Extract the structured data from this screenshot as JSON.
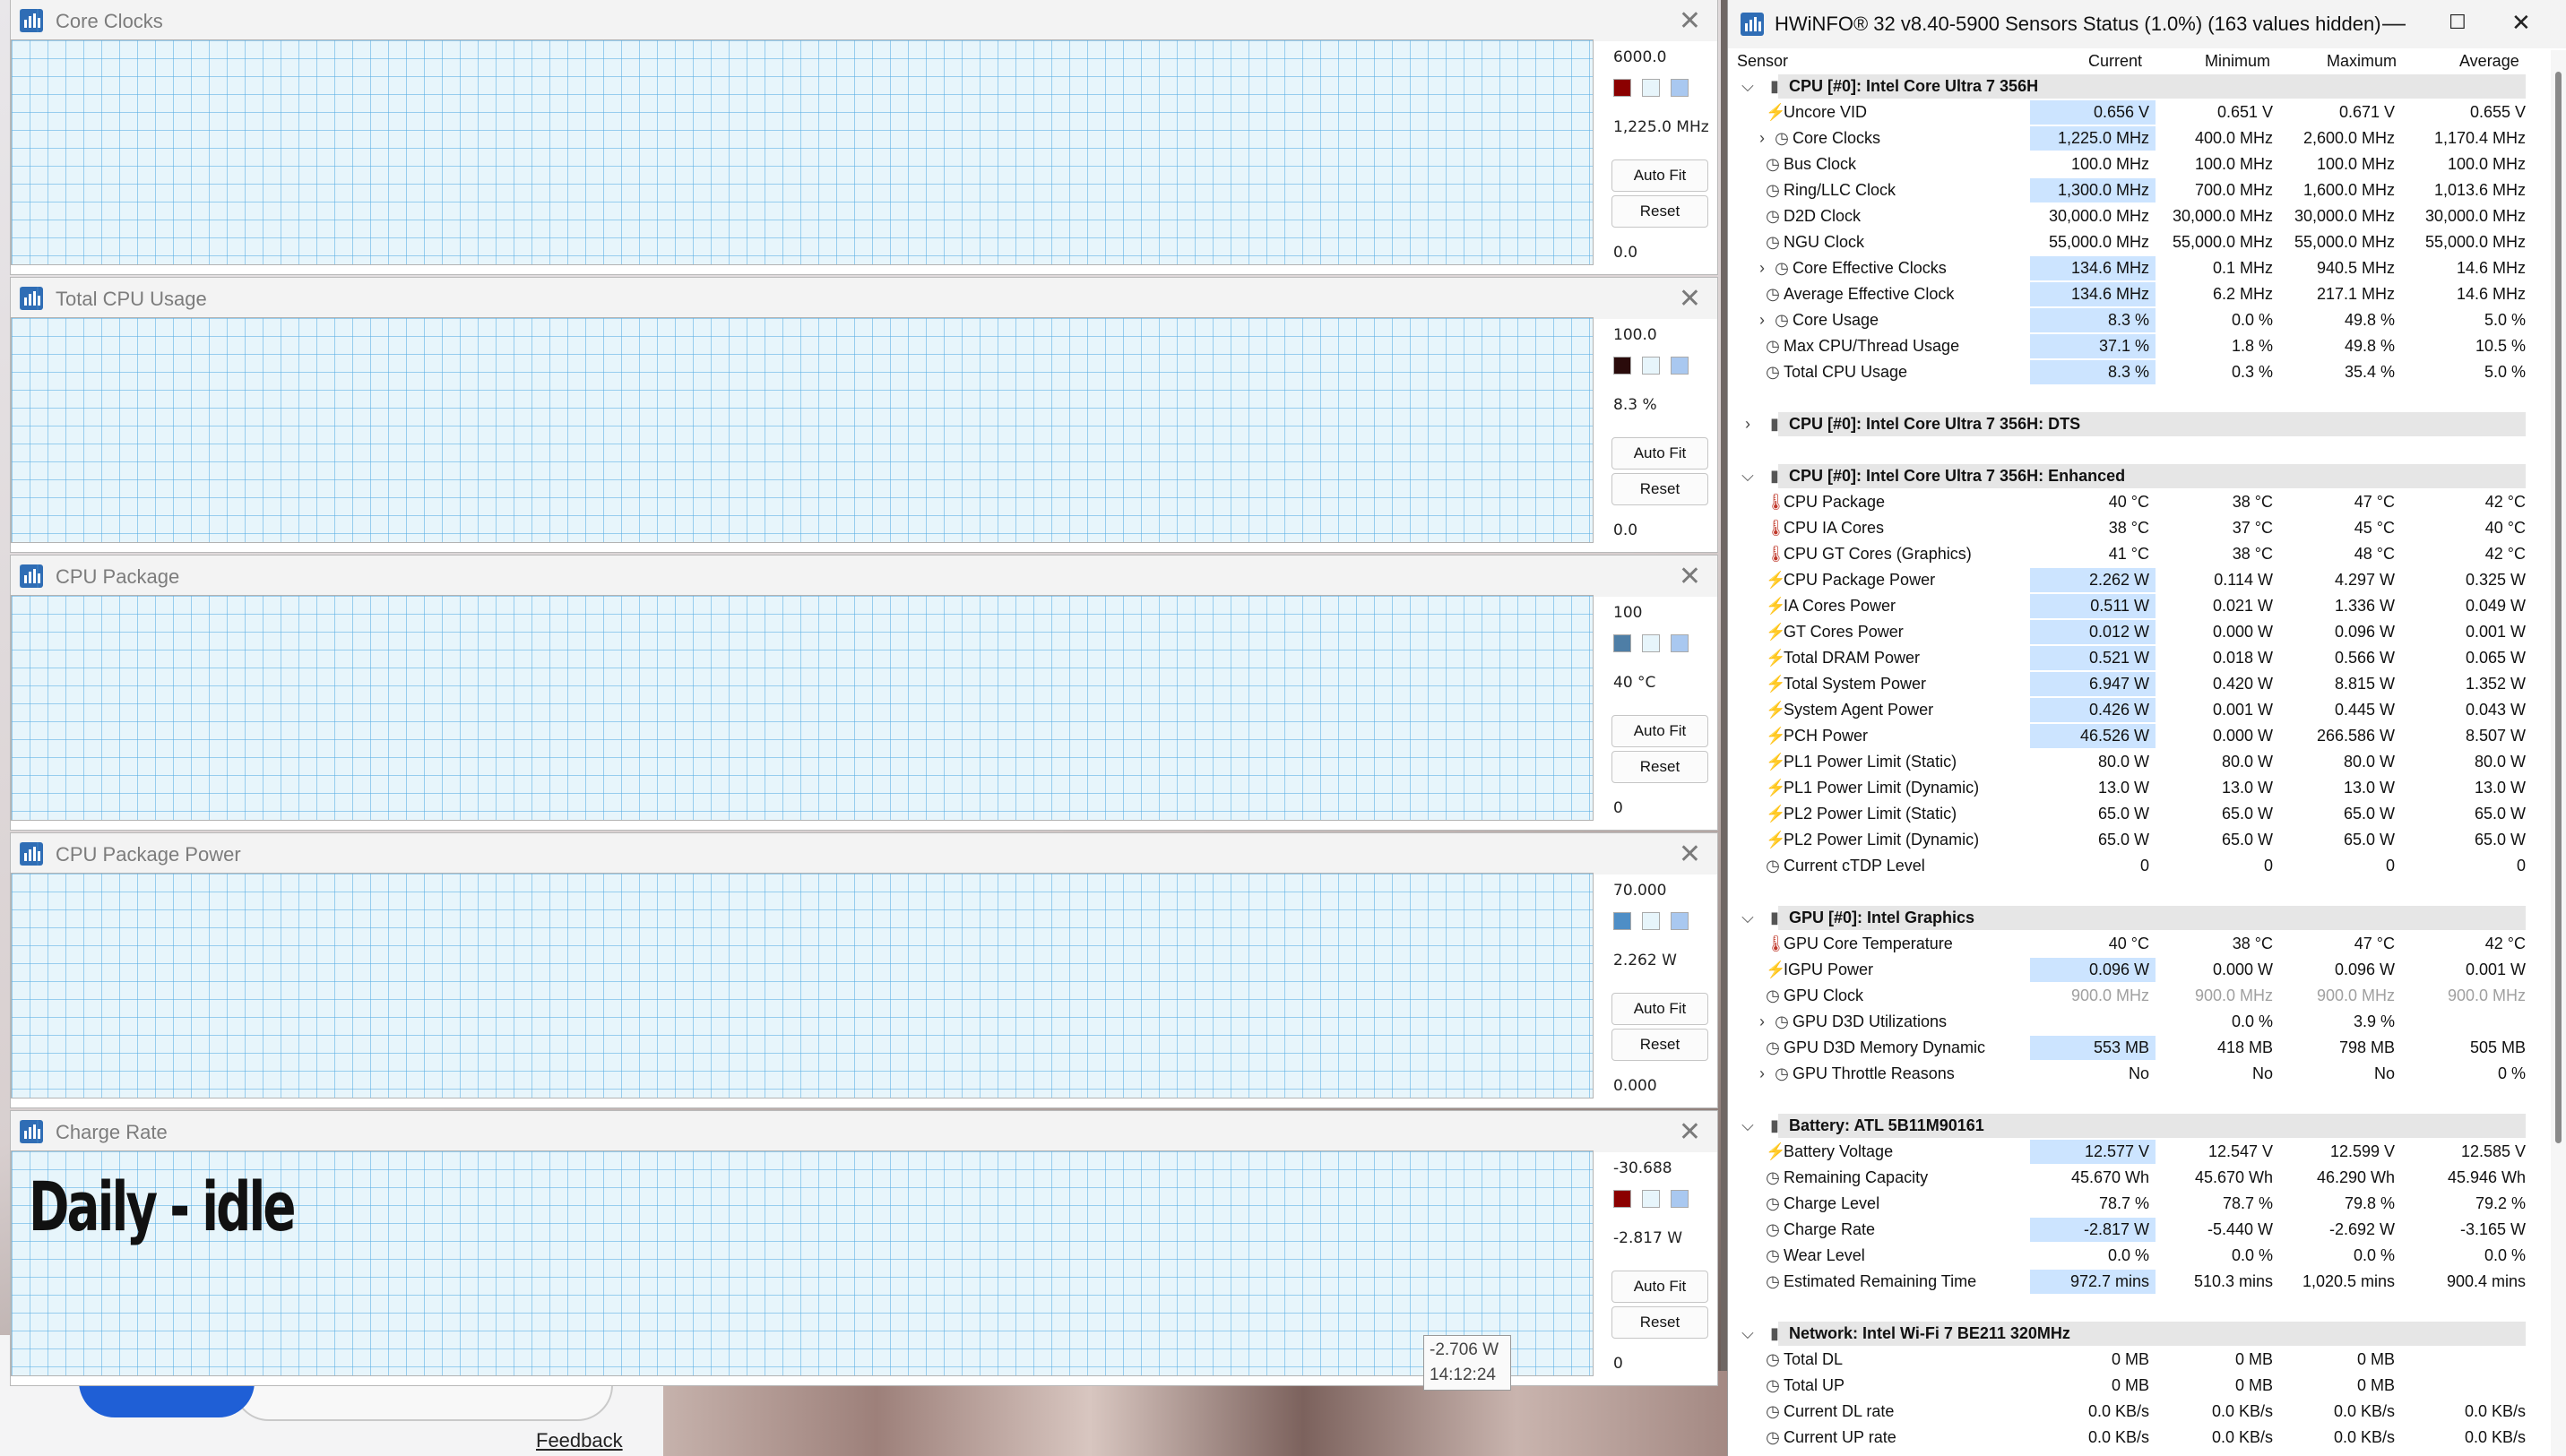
{
  "graphs": [
    {
      "title": "Core Clocks",
      "max": "6000.0",
      "cur": "1,225.0 MHz",
      "min": "0.0",
      "autofit": "Auto Fit",
      "reset": "Reset",
      "color": "#a50f0f",
      "sw1": "#8b0000",
      "sw2": "#e7f5fb",
      "sw3": "#a9c8f0"
    },
    {
      "title": "Total CPU Usage",
      "max": "100.0",
      "cur": "8.3 %",
      "min": "0.0",
      "autofit": "Auto Fit",
      "reset": "Reset",
      "color": "#5e1214",
      "sw1": "#2a0b0b",
      "sw2": "#e7f5fb",
      "sw3": "#a9c8f0"
    },
    {
      "title": "CPU Package",
      "max": "100",
      "cur": "40 °C",
      "min": "0",
      "autofit": "Auto Fit",
      "reset": "Reset",
      "color": "#254350",
      "sw1": "#4e7ea6",
      "sw2": "#e7f5fb",
      "sw3": "#a9c8f0"
    },
    {
      "title": "CPU Package Power",
      "max": "70.000",
      "cur": "2.262 W",
      "min": "0.000",
      "autofit": "Auto Fit",
      "reset": "Reset",
      "color": "#254350",
      "sw1": "#4e8ec6",
      "sw2": "#e7f5fb",
      "sw3": "#a9c8f0"
    },
    {
      "title": "Charge Rate",
      "max": "-30.688",
      "cur": "-2.817 W",
      "min": "0",
      "autofit": "Auto Fit",
      "reset": "Reset",
      "color": "#a50f0f",
      "sw1": "#8b0000",
      "sw2": "#e7f5fb",
      "sw3": "#a9c8f0"
    }
  ],
  "overlay": {
    "text": "Daily - idle",
    "tooltip_value": "-2.706 W",
    "tooltip_time": "14:12:24"
  },
  "desktop": {
    "feedback": "Feedback"
  },
  "hwinfo": {
    "title": "HWiNFO® 32 v8.40-5900 Sensors Status (1.0%) (163 values hidden)",
    "columns": {
      "sensor": "Sensor",
      "current": "Current",
      "minimum": "Minimum",
      "maximum": "Maximum",
      "average": "Average"
    },
    "rows": [
      {
        "t": "g",
        "name": "CPU [#0]: Intel Core Ultra 7 356H",
        "exp": "v"
      },
      {
        "t": "r",
        "icon": "bolt",
        "name": "Uncore VID",
        "cur": "0.656 V",
        "min": "0.651 V",
        "max": "0.671 V",
        "avg": "0.655 V",
        "hl": true
      },
      {
        "t": "r",
        "icon": "clock",
        "exp": ">",
        "name": "Core Clocks",
        "cur": "1,225.0 MHz",
        "min": "400.0 MHz",
        "max": "2,600.0 MHz",
        "avg": "1,170.4 MHz",
        "hl": true,
        "sub": true
      },
      {
        "t": "r",
        "icon": "clock",
        "name": "Bus Clock",
        "cur": "100.0 MHz",
        "min": "100.0 MHz",
        "max": "100.0 MHz",
        "avg": "100.0 MHz"
      },
      {
        "t": "r",
        "icon": "clock",
        "name": "Ring/LLC Clock",
        "cur": "1,300.0 MHz",
        "min": "700.0 MHz",
        "max": "1,600.0 MHz",
        "avg": "1,013.6 MHz",
        "hl": true
      },
      {
        "t": "r",
        "icon": "clock",
        "name": "D2D Clock",
        "cur": "30,000.0 MHz",
        "min": "30,000.0 MHz",
        "max": "30,000.0 MHz",
        "avg": "30,000.0 MHz"
      },
      {
        "t": "r",
        "icon": "clock",
        "name": "NGU Clock",
        "cur": "55,000.0 MHz",
        "min": "55,000.0 MHz",
        "max": "55,000.0 MHz",
        "avg": "55,000.0 MHz"
      },
      {
        "t": "r",
        "icon": "clock",
        "exp": ">",
        "name": "Core Effective Clocks",
        "cur": "134.6 MHz",
        "min": "0.1 MHz",
        "max": "940.5 MHz",
        "avg": "14.6 MHz",
        "hl": true,
        "sub": true
      },
      {
        "t": "r",
        "icon": "clock",
        "name": "Average Effective Clock",
        "cur": "134.6 MHz",
        "min": "6.2 MHz",
        "max": "217.1 MHz",
        "avg": "14.6 MHz",
        "hl": true
      },
      {
        "t": "r",
        "icon": "clock",
        "exp": ">",
        "name": "Core Usage",
        "cur": "8.3 %",
        "min": "0.0 %",
        "max": "49.8 %",
        "avg": "5.0 %",
        "hl": true,
        "sub": true
      },
      {
        "t": "r",
        "icon": "clock",
        "name": "Max CPU/Thread Usage",
        "cur": "37.1 %",
        "min": "1.8 %",
        "max": "49.8 %",
        "avg": "10.5 %",
        "hl": true
      },
      {
        "t": "r",
        "icon": "clock",
        "name": "Total CPU Usage",
        "cur": "8.3 %",
        "min": "0.3 %",
        "max": "35.4 %",
        "avg": "5.0 %",
        "hl": true
      },
      {
        "t": "s"
      },
      {
        "t": "g",
        "name": "CPU [#0]: Intel Core Ultra 7 356H: DTS",
        "exp": ">"
      },
      {
        "t": "s"
      },
      {
        "t": "g",
        "name": "CPU [#0]: Intel Core Ultra 7 356H: Enhanced",
        "exp": "v"
      },
      {
        "t": "r",
        "icon": "temp",
        "name": "CPU Package",
        "cur": "40 °C",
        "min": "38 °C",
        "max": "47 °C",
        "avg": "42 °C"
      },
      {
        "t": "r",
        "icon": "temp",
        "name": "CPU IA Cores",
        "cur": "38 °C",
        "min": "37 °C",
        "max": "45 °C",
        "avg": "40 °C"
      },
      {
        "t": "r",
        "icon": "temp",
        "name": "CPU GT Cores (Graphics)",
        "cur": "41 °C",
        "min": "38 °C",
        "max": "48 °C",
        "avg": "42 °C"
      },
      {
        "t": "r",
        "icon": "bolt",
        "name": "CPU Package Power",
        "cur": "2.262 W",
        "min": "0.114 W",
        "max": "4.297 W",
        "avg": "0.325 W",
        "hl": true
      },
      {
        "t": "r",
        "icon": "bolt",
        "name": "IA Cores Power",
        "cur": "0.511 W",
        "min": "0.021 W",
        "max": "1.336 W",
        "avg": "0.049 W",
        "hl": true
      },
      {
        "t": "r",
        "icon": "bolt",
        "name": "GT Cores Power",
        "cur": "0.012 W",
        "min": "0.000 W",
        "max": "0.096 W",
        "avg": "0.001 W",
        "hl": true
      },
      {
        "t": "r",
        "icon": "bolt",
        "name": "Total DRAM Power",
        "cur": "0.521 W",
        "min": "0.018 W",
        "max": "0.566 W",
        "avg": "0.065 W",
        "hl": true
      },
      {
        "t": "r",
        "icon": "bolt",
        "name": "Total System Power",
        "cur": "6.947 W",
        "min": "0.420 W",
        "max": "8.815 W",
        "avg": "1.352 W",
        "hl": true
      },
      {
        "t": "r",
        "icon": "bolt",
        "name": "System Agent Power",
        "cur": "0.426 W",
        "min": "0.001 W",
        "max": "0.445 W",
        "avg": "0.043 W",
        "hl": true
      },
      {
        "t": "r",
        "icon": "bolt",
        "name": "PCH Power",
        "cur": "46.526 W",
        "min": "0.000 W",
        "max": "266.586 W",
        "avg": "8.507 W",
        "hl": true
      },
      {
        "t": "r",
        "icon": "bolt",
        "name": "PL1 Power Limit (Static)",
        "cur": "80.0 W",
        "min": "80.0 W",
        "max": "80.0 W",
        "avg": "80.0 W"
      },
      {
        "t": "r",
        "icon": "bolt",
        "name": "PL1 Power Limit (Dynamic)",
        "cur": "13.0 W",
        "min": "13.0 W",
        "max": "13.0 W",
        "avg": "13.0 W"
      },
      {
        "t": "r",
        "icon": "bolt",
        "name": "PL2 Power Limit (Static)",
        "cur": "65.0 W",
        "min": "65.0 W",
        "max": "65.0 W",
        "avg": "65.0 W"
      },
      {
        "t": "r",
        "icon": "bolt",
        "name": "PL2 Power Limit (Dynamic)",
        "cur": "65.0 W",
        "min": "65.0 W",
        "max": "65.0 W",
        "avg": "65.0 W"
      },
      {
        "t": "r",
        "icon": "clock",
        "name": "Current cTDP Level",
        "cur": "0",
        "min": "0",
        "max": "0",
        "avg": "0"
      },
      {
        "t": "s"
      },
      {
        "t": "g",
        "name": "GPU [#0]: Intel Graphics",
        "exp": "v"
      },
      {
        "t": "r",
        "icon": "temp",
        "name": "GPU Core Temperature",
        "cur": "40 °C",
        "min": "38 °C",
        "max": "47 °C",
        "avg": "42 °C"
      },
      {
        "t": "r",
        "icon": "bolt",
        "name": "IGPU Power",
        "cur": "0.096 W",
        "min": "0.000 W",
        "max": "0.096 W",
        "avg": "0.001 W",
        "hl": true
      },
      {
        "t": "r",
        "icon": "clock",
        "name": "GPU Clock",
        "cur": "900.0 MHz",
        "min": "900.0 MHz",
        "max": "900.0 MHz",
        "avg": "900.0 MHz",
        "dim": true
      },
      {
        "t": "r",
        "icon": "clock",
        "exp": ">",
        "name": "GPU D3D Utilizations",
        "cur": "",
        "min": "0.0 %",
        "max": "3.9 %",
        "avg": "",
        "sub": true
      },
      {
        "t": "r",
        "icon": "clock",
        "name": "GPU D3D Memory Dynamic",
        "cur": "553 MB",
        "min": "418 MB",
        "max": "798 MB",
        "avg": "505 MB",
        "hl": true
      },
      {
        "t": "r",
        "icon": "clock",
        "exp": ">",
        "name": "GPU Throttle Reasons",
        "cur": "No",
        "min": "No",
        "max": "No",
        "avg": "0 %",
        "sub": true
      },
      {
        "t": "s"
      },
      {
        "t": "g",
        "name": "Battery: ATL 5B11M90161",
        "exp": "v"
      },
      {
        "t": "r",
        "icon": "bolt",
        "name": "Battery Voltage",
        "cur": "12.577 V",
        "min": "12.547 V",
        "max": "12.599 V",
        "avg": "12.585 V",
        "hl": true
      },
      {
        "t": "r",
        "icon": "clock",
        "name": "Remaining Capacity",
        "cur": "45.670 Wh",
        "min": "45.670 Wh",
        "max": "46.290 Wh",
        "avg": "45.946 Wh"
      },
      {
        "t": "r",
        "icon": "clock",
        "name": "Charge Level",
        "cur": "78.7 %",
        "min": "78.7 %",
        "max": "79.8 %",
        "avg": "79.2 %"
      },
      {
        "t": "r",
        "icon": "clock",
        "name": "Charge Rate",
        "cur": "-2.817 W",
        "min": "-5.440 W",
        "max": "-2.692 W",
        "avg": "-3.165 W",
        "hl": true
      },
      {
        "t": "r",
        "icon": "clock",
        "name": "Wear Level",
        "cur": "0.0 %",
        "min": "0.0 %",
        "max": "0.0 %",
        "avg": "0.0 %"
      },
      {
        "t": "r",
        "icon": "clock",
        "name": "Estimated Remaining Time",
        "cur": "972.7 mins",
        "min": "510.3 mins",
        "max": "1,020.5 mins",
        "avg": "900.4 mins",
        "hl": true
      },
      {
        "t": "s"
      },
      {
        "t": "g",
        "name": "Network: Intel Wi-Fi 7 BE211 320MHz",
        "exp": "v"
      },
      {
        "t": "r",
        "icon": "clock",
        "name": "Total DL",
        "cur": "0 MB",
        "min": "0 MB",
        "max": "0 MB",
        "avg": ""
      },
      {
        "t": "r",
        "icon": "clock",
        "name": "Total UP",
        "cur": "0 MB",
        "min": "0 MB",
        "max": "0 MB",
        "avg": ""
      },
      {
        "t": "r",
        "icon": "clock",
        "name": "Current DL rate",
        "cur": "0.0 KB/s",
        "min": "0.0 KB/s",
        "max": "0.0 KB/s",
        "avg": "0.0 KB/s"
      },
      {
        "t": "r",
        "icon": "clock",
        "name": "Current UP rate",
        "cur": "0.0 KB/s",
        "min": "0.0 KB/s",
        "max": "0.0 KB/s",
        "avg": "0.0 KB/s"
      }
    ]
  },
  "colors": {
    "highlight": "#cce4ff",
    "group_bg": "#e6e6e6",
    "bolt": "#f0a000",
    "temp": "#c0392b"
  }
}
